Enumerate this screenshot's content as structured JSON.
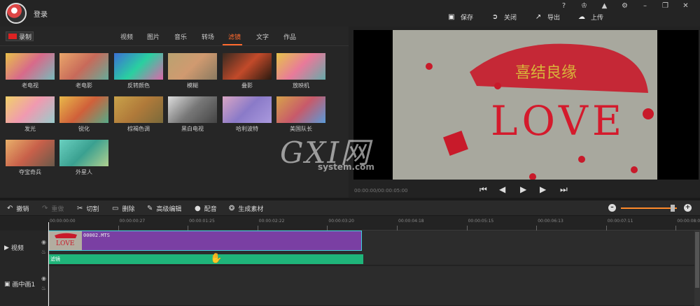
{
  "header": {
    "login": "登录",
    "actions": [
      {
        "label": "保存",
        "icon": "save-icon"
      },
      {
        "label": "关闭",
        "icon": "close-doc-icon"
      },
      {
        "label": "导出",
        "icon": "export-icon"
      },
      {
        "label": "上传",
        "icon": "upload-icon"
      }
    ],
    "window_buttons": [
      "?",
      "♔",
      "🔔",
      "⚙",
      "–",
      "❐",
      "✕"
    ]
  },
  "media": {
    "record_label": "录制",
    "tabs": [
      "视频",
      "图片",
      "音乐",
      "转场",
      "滤镜",
      "文字",
      "作品"
    ],
    "active_tab": "滤镜",
    "filters": [
      "老电视",
      "老电影",
      "反转颜色",
      "模糊",
      "叠影",
      "放映机",
      "发光",
      "锐化",
      "棕褐色调",
      "黑白电视",
      "哈利波特",
      "美国队长",
      "夺宝奇兵",
      "外星人"
    ]
  },
  "preview": {
    "timecode": "00:00:00/00:00:05:00",
    "photo_text": "LOVE",
    "banner_text": "喜结良缘",
    "watermark_main": "GXI网",
    "watermark_sub": "system.com"
  },
  "toolbar": {
    "items": [
      {
        "label": "撤销",
        "icon": "undo-icon",
        "enabled": true
      },
      {
        "label": "重做",
        "icon": "redo-icon",
        "enabled": false
      },
      {
        "label": "切割",
        "icon": "scissors-icon",
        "enabled": true
      },
      {
        "label": "删除",
        "icon": "trash-icon",
        "enabled": true
      },
      {
        "label": "高级编辑",
        "icon": "pencil-icon",
        "enabled": true
      },
      {
        "label": "配音",
        "icon": "microphone-icon",
        "enabled": true
      },
      {
        "label": "生成素材",
        "icon": "film-reel-icon",
        "enabled": true
      }
    ],
    "zoom_level": 0.93
  },
  "ruler": {
    "ticks": [
      "00:00:00:00",
      "00:00:00:27",
      "00:00:01:25",
      "00:00:02:22",
      "00:00:03:20",
      "00:00:04:18",
      "00:00:05:15",
      "00:00:06:13",
      "00:00:07:11",
      "00:00:08:0"
    ]
  },
  "tracks": {
    "video_label": "视频",
    "pip_label": "画中画1",
    "clip_name": "00002.MTS",
    "filter_label": "滤镜"
  },
  "colors": {
    "accent": "#ff6a2e",
    "clip": "#7a3fa3",
    "clip_border": "#3fd3e0",
    "filter": "#1fb57a"
  }
}
